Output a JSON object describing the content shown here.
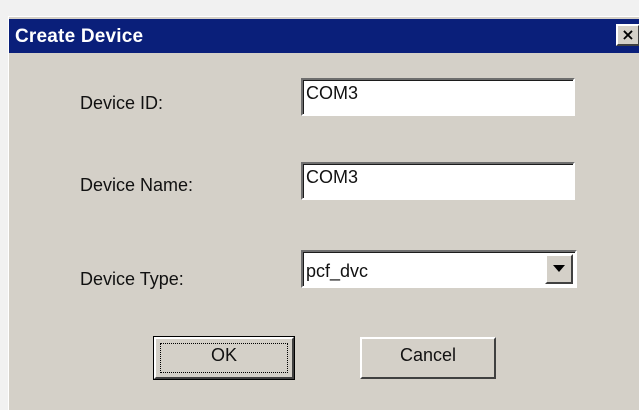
{
  "dialog": {
    "title": "Create Device",
    "close_icon": "close-icon",
    "close_glyph": "×"
  },
  "form": {
    "device_id_label": "Device ID:",
    "device_id_value": "COM3",
    "device_name_label": "Device Name:",
    "device_name_value": "COM3",
    "device_type_label": "Device Type:",
    "device_type_value": "pcf_dvc",
    "dropdown_icon": "chevron-down-icon"
  },
  "buttons": {
    "ok_label": "OK",
    "cancel_label": "Cancel"
  },
  "colors": {
    "titlebar": "#0a1f7a",
    "dialog_bg": "#d4d0c8"
  }
}
